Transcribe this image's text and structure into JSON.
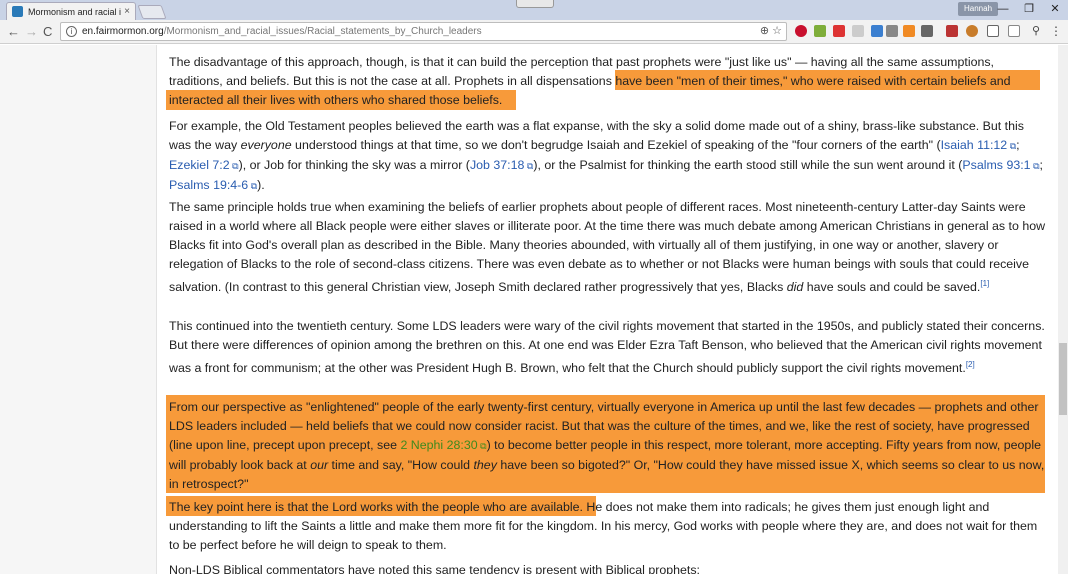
{
  "browser": {
    "tab_title": "Mormonism and racial is",
    "tab_close": "×",
    "profile_name": "Hannah",
    "url_domain": "en.fairmormon.org",
    "url_path": "/Mormonism_and_racial_issues/Racial_statements_by_Church_leaders",
    "back_glyph": "←",
    "forward_glyph": "→",
    "reload_glyph": "C",
    "zoom_glyph": "⊕",
    "star_glyph": "☆",
    "info_glyph": "i",
    "minimize_glyph": "—",
    "restore_glyph": "❐",
    "close_glyph": "✕",
    "menu_glyph": "⋮"
  },
  "article": {
    "p1_a": "The disadvantage of this approach, though, is that it can build the perception that past prophets were \"just like us\" — having all the same assumptions, traditions, and beliefs. But this is not the case at all. ",
    "p1_hl_a": "Prophets in all dispensations have been \"men of their times,\" who were raised with certain beliefs and",
    "p1_hl_b": "interacted all their lives with others who shared those beliefs.",
    "p2_a": "For example, the Old Testament peoples believed the earth was a flat expanse, with the sky a solid dome made out of a shiny, brass-like substance. But this was the way ",
    "p2_em": "everyone",
    "p2_b": " understood things at that time, so we don't begrudge Isaiah and Ezekiel of speaking of the \"four corners of the earth\" (",
    "p2_link1": "Isaiah 11:12",
    "p2_sep1": "; ",
    "p2_link2": "Ezekiel 7:2",
    "p2_c": "), or Job for thinking the sky was a mirror (",
    "p2_link3": "Job 37:18",
    "p2_d": "), or the Psalmist for thinking the earth stood still while the sun went around it (",
    "p2_link4": "Psalms 93:1",
    "p2_sep2": "; ",
    "p2_link5": "Psalms 19:4-6",
    "p2_e": ").",
    "p3_a": "The same principle holds true when examining the beliefs of earlier prophets about people of different races. Most nineteenth-century Latter-day Saints were raised in a world where all Black people were either slaves or illiterate poor. At the time there was much debate among American Christians in general as to how Blacks fit into God's overall plan as described in the Bible. Many theories abounded, with virtually all of them justifying, in one way or another, slavery or relegation of Blacks to the role of second-class citizens. There was even debate as to whether or not Blacks were human beings with souls that could receive salvation. (In contrast to this general Christian view, Joseph Smith declared rather progressively that yes, Blacks ",
    "p3_em": "did",
    "p3_b": " have souls and could be saved.",
    "p3_ref": "[1]",
    "p4_a": "This continued into the twentieth century. Some LDS leaders were wary of the civil rights movement that started in the 1950s, and publicly stated their concerns. But there were differences of opinion among the brethren on this. At one end was Elder Ezra Taft Benson, who believed that the American civil rights movement was a front for communism; at the other was President Hugh B. Brown, who felt that the Church should publicly support the civil rights movement.",
    "p4_ref": "[2]",
    "p5_a": "From our perspective as \"enlightened\" people of the early twenty-first century, virtually everyone in America up until the last few decades — prophets and other LDS leaders included — held beliefs that we could now consider racist. But that was the culture of the times, and we, like the rest of society, have progressed (line upon line, precept upon precept, see ",
    "p5_link": "2 Nephi 28:30",
    "p5_b": ") to become better people in this respect, more tolerant, more accepting. Fifty years from now, people will probably look back at ",
    "p5_em1": "our",
    "p5_c": " time and say, \"How could ",
    "p5_em2": "they",
    "p5_d": " have been so bigoted?\" Or, \"How could they have missed issue X, which seems so clear to us now, in retrospect?\"",
    "p6_hl": "The key point here is that the Lord works with the people who are available.",
    "p6_a": " He does not make them into radicals; he gives them just enough light and understanding to lift the Saints a little and make them more fit for the kingdom. In his mercy, God works with people where they are, and does not wait for them to be perfect before he will deign to speak to them.",
    "p7_a": "Non-LDS Biblical commentators have noted this same tendency is present with Biblical prophets:"
  },
  "colors": {
    "highlight": "#f79a3a",
    "link": "#2a5db0",
    "green_link": "#3f8a1e"
  }
}
